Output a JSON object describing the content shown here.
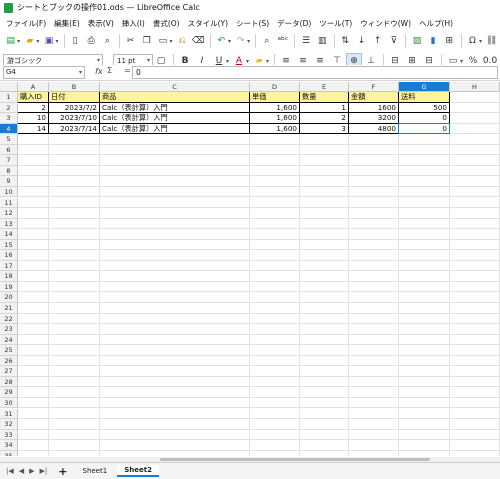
{
  "window": {
    "title": "シートとブックの操作01.ods — LibreOffice Calc"
  },
  "menu": [
    "ファイル(F)",
    "編集(E)",
    "表示(V)",
    "挿入(I)",
    "書式(O)",
    "スタイル(Y)",
    "シート(S)",
    "データ(D)",
    "ツール(T)",
    "ウィンドウ(W)",
    "ヘルプ(H)"
  ],
  "format": {
    "font_name": "游ゴシック",
    "font_size": "11 pt"
  },
  "formula_bar": {
    "name_box": "G4",
    "fx": "fx",
    "sigma": "Σ",
    "equals": "=",
    "content": "0"
  },
  "columns": [
    "A",
    "B",
    "C",
    "D",
    "E",
    "F",
    "G",
    "H"
  ],
  "rows": [
    "1",
    "2",
    "3",
    "4",
    "5",
    "6",
    "7",
    "8",
    "9",
    "10",
    "11",
    "12",
    "13",
    "14",
    "15",
    "16",
    "17",
    "18",
    "19",
    "20",
    "21",
    "22",
    "23",
    "24",
    "25",
    "26",
    "27",
    "28",
    "29",
    "30",
    "31",
    "32",
    "33",
    "34",
    "35"
  ],
  "table": {
    "header": [
      "購入ID",
      "日付",
      "商品",
      "単価",
      "数量",
      "金額",
      "送料"
    ],
    "rows": [
      [
        "2",
        "2023/7/2",
        "Calc（表計算）入門",
        "1,600",
        "1",
        "1600",
        "500"
      ],
      [
        "10",
        "2023/7/10",
        "Calc（表計算）入門",
        "1,600",
        "2",
        "3200",
        "0"
      ],
      [
        "14",
        "2023/7/14",
        "Calc（表計算）入門",
        "1,600",
        "3",
        "4800",
        "0"
      ]
    ]
  },
  "selected_cell": "G4",
  "sheets": [
    {
      "name": "Sheet1",
      "active": false
    },
    {
      "name": "Sheet2",
      "active": true
    }
  ],
  "colors": {
    "selection": "#1c7bd1",
    "header_fill": "#fdf3a0"
  }
}
